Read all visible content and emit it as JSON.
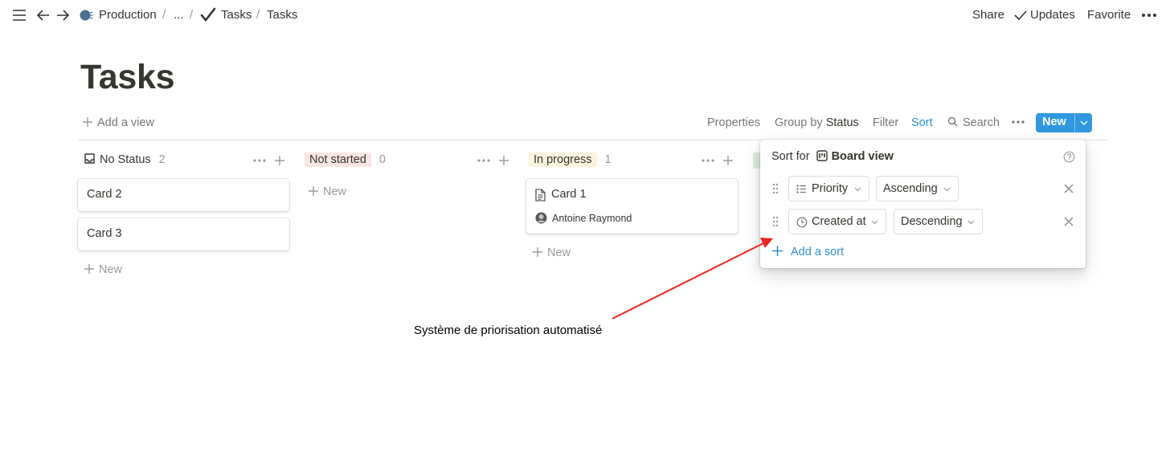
{
  "breadcrumb": {
    "workspace": "Production",
    "ellipsis": "...",
    "sep": "/",
    "parent": "Tasks",
    "current": "Tasks"
  },
  "topbar": {
    "share": "Share",
    "updates": "Updates",
    "favorite": "Favorite"
  },
  "page": {
    "title": "Tasks"
  },
  "toolbar": {
    "add_view": "Add a view",
    "properties": "Properties",
    "group_by_label": "Group by",
    "group_by_value": "Status",
    "filter": "Filter",
    "sort": "Sort",
    "search": "Search",
    "new": "New"
  },
  "board": {
    "columns": [
      {
        "name": "No Status",
        "count": "2",
        "color": "#ffffff",
        "cards": [
          "Card 2",
          "Card 3"
        ],
        "new": "New"
      },
      {
        "name": "Not started",
        "count": "0",
        "color": "#fbe4e4",
        "cards": [],
        "new": "New"
      },
      {
        "name": "In progress",
        "count": "1",
        "color": "#fbf3db",
        "cards": [
          "Card 1"
        ],
        "card_person": "Antoine Raymond",
        "new": "New"
      }
    ]
  },
  "sort_popup": {
    "label": "Sort for",
    "view_name": "Board view",
    "rules": [
      {
        "property": "Priority",
        "direction": "Ascending"
      },
      {
        "property": "Created at",
        "direction": "Descending"
      }
    ],
    "add_sort": "Add a sort"
  },
  "annotation": {
    "text": "Système de priorisation automatisé",
    "arrow_color": "#e8281e"
  }
}
